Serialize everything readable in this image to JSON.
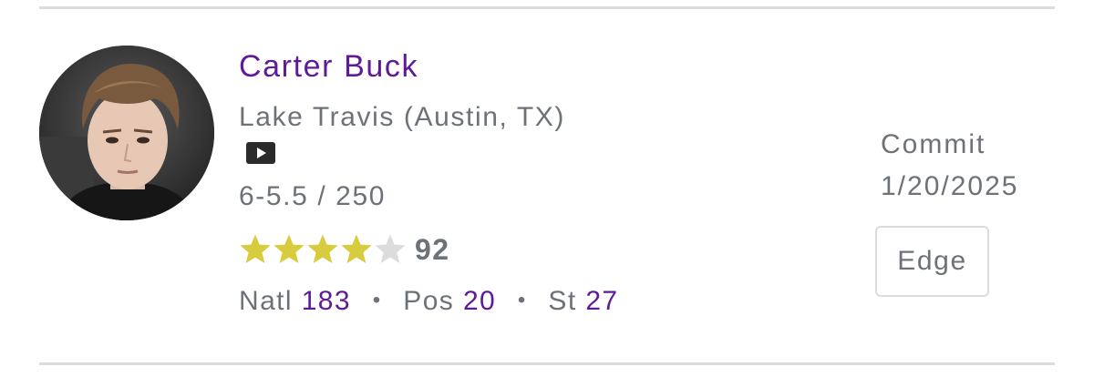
{
  "player": {
    "name": "Carter Buck",
    "school": "Lake Travis (Austin, TX)",
    "measurements": "6-5.5 / 250",
    "video_icon": "video-play-icon",
    "rating": {
      "stars_filled": 4,
      "stars_total": 5,
      "score": "92",
      "star_color": "#d6cc3d",
      "star_empty_color": "#dcdcdc"
    },
    "ranks": {
      "natl_label": "Natl",
      "natl_value": "183",
      "pos_label": "Pos",
      "pos_value": "20",
      "st_label": "St",
      "st_value": "27",
      "separator": "•"
    }
  },
  "status": {
    "label": "Commit",
    "date": "1/20/2025"
  },
  "position_button": {
    "label": "Edge"
  },
  "colors": {
    "accent": "#5f1a98",
    "text_gray": "#6d7178",
    "border": "#dcdcdc"
  }
}
